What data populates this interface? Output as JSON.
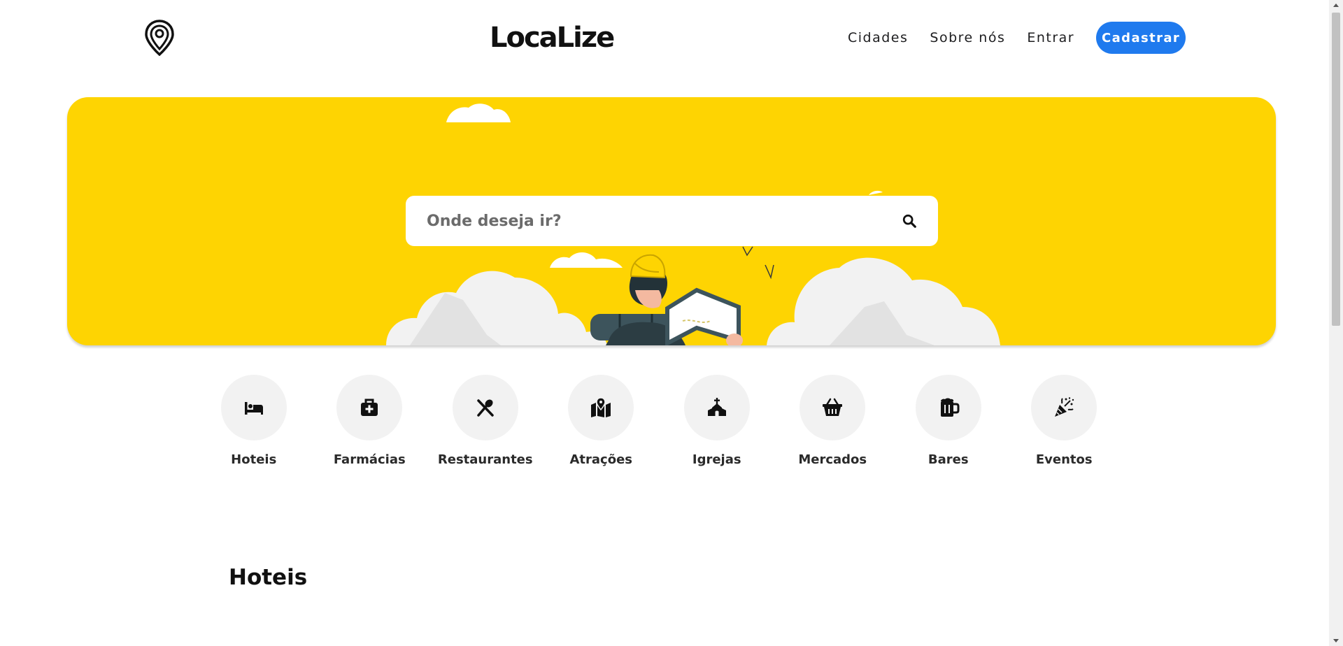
{
  "header": {
    "brand": "LocaLize",
    "logo_icon": "map-pin-icon",
    "nav": [
      {
        "label": "Cidades"
      },
      {
        "label": "Sobre nós"
      },
      {
        "label": "Entrar"
      }
    ],
    "cta_label": "Cadastrar"
  },
  "colors": {
    "accent": "#1f7aee",
    "hero_bg": "#fed402",
    "cloud": "#f2f2f2"
  },
  "hero": {
    "search_placeholder": "Onde deseja ir?",
    "search_icon": "search-icon"
  },
  "categories": [
    {
      "label": "Hoteis",
      "icon": "bed-icon"
    },
    {
      "label": "Farmácias",
      "icon": "medical-kit-icon"
    },
    {
      "label": "Restaurantes",
      "icon": "utensils-icon"
    },
    {
      "label": "Atrações",
      "icon": "map-location-icon"
    },
    {
      "label": "Igrejas",
      "icon": "church-icon"
    },
    {
      "label": "Mercados",
      "icon": "basket-icon"
    },
    {
      "label": "Bares",
      "icon": "beer-mug-icon"
    },
    {
      "label": "Eventos",
      "icon": "party-popper-icon"
    }
  ],
  "section": {
    "title": "Hoteis"
  }
}
